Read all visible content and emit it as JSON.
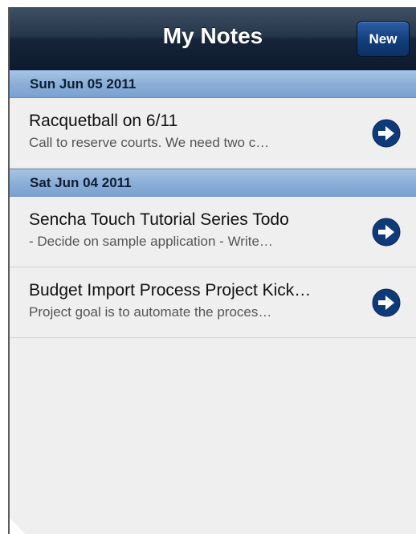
{
  "toolbar": {
    "title": "My Notes",
    "new_label": "New"
  },
  "groups": [
    {
      "date": "Sun Jun 05 2011",
      "notes": [
        {
          "title": "Racquetball on 6/11",
          "snippet": "Call to reserve courts. We need two c…"
        }
      ]
    },
    {
      "date": "Sat Jun 04 2011",
      "notes": [
        {
          "title": "Sencha Touch Tutorial Series Todo",
          "snippet": "- Decide on sample application - Write…"
        },
        {
          "title": "Budget Import Process Project Kick…",
          "snippet": "Project goal is to automate the proces…"
        }
      ]
    }
  ],
  "icons": {
    "disclosure": "arrow-right-circle-icon"
  },
  "colors": {
    "toolbar": "#1a2a40",
    "group_header": "#8cafd8",
    "disclosure": "#0e3a78",
    "list_background": "#efefef"
  }
}
